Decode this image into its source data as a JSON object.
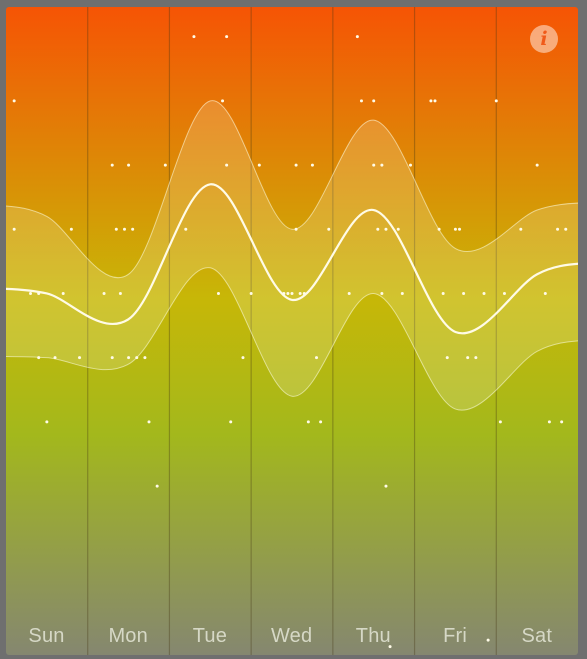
{
  "chart_data": {
    "type": "line",
    "categories": [
      "Sun",
      "Mon",
      "Tue",
      "Wed",
      "Thu",
      "Fri",
      "Sat"
    ],
    "ylim": [
      0,
      10
    ],
    "gradient_colors": [
      "#f65405",
      "#c7b707",
      "#a3b81c",
      "#858770"
    ],
    "series": [
      {
        "values": [
          5.6,
          5.2,
          7.3,
          5.5,
          6.9,
          5.0,
          5.9
        ]
      }
    ],
    "band": {
      "upper": [
        6.8,
        5.9,
        8.6,
        6.6,
        8.3,
        6.3,
        6.9
      ],
      "lower": [
        4.6,
        4.5,
        6.0,
        4.0,
        5.6,
        3.8,
        4.7
      ]
    },
    "points": [
      [
        0.1,
        8.6
      ],
      [
        0.1,
        6.6
      ],
      [
        0.3,
        5.6
      ],
      [
        0.4,
        5.6
      ],
      [
        0.4,
        4.6
      ],
      [
        0.5,
        3.6
      ],
      [
        0.6,
        4.6
      ],
      [
        0.7,
        5.6
      ],
      [
        0.8,
        6.6
      ],
      [
        0.9,
        4.6
      ],
      [
        1.2,
        5.6
      ],
      [
        1.3,
        7.6
      ],
      [
        1.3,
        4.6
      ],
      [
        1.35,
        6.6
      ],
      [
        1.4,
        5.6
      ],
      [
        1.45,
        6.6
      ],
      [
        1.5,
        7.6
      ],
      [
        1.5,
        4.6
      ],
      [
        1.55,
        6.6
      ],
      [
        1.6,
        4.6
      ],
      [
        1.7,
        4.6
      ],
      [
        1.75,
        3.6
      ],
      [
        1.85,
        2.6
      ],
      [
        1.95,
        7.6
      ],
      [
        2.2,
        6.6
      ],
      [
        2.3,
        9.6
      ],
      [
        2.6,
        5.6
      ],
      [
        2.65,
        8.6
      ],
      [
        2.7,
        7.6
      ],
      [
        2.7,
        9.6
      ],
      [
        2.75,
        3.6
      ],
      [
        2.9,
        4.6
      ],
      [
        3.0,
        5.6
      ],
      [
        3.1,
        7.6
      ],
      [
        3.4,
        5.6
      ],
      [
        3.45,
        5.6
      ],
      [
        3.5,
        5.6
      ],
      [
        3.55,
        7.6
      ],
      [
        3.55,
        6.6
      ],
      [
        3.6,
        5.6
      ],
      [
        3.65,
        5.6
      ],
      [
        3.7,
        3.6
      ],
      [
        3.75,
        7.6
      ],
      [
        3.8,
        4.6
      ],
      [
        3.85,
        3.6
      ],
      [
        3.95,
        6.6
      ],
      [
        4.2,
        5.6
      ],
      [
        4.3,
        9.6
      ],
      [
        4.35,
        8.6
      ],
      [
        4.5,
        8.6
      ],
      [
        4.5,
        7.6
      ],
      [
        4.55,
        6.6
      ],
      [
        4.6,
        7.6
      ],
      [
        4.6,
        5.6
      ],
      [
        4.65,
        6.6
      ],
      [
        4.65,
        2.6
      ],
      [
        4.7,
        0.1
      ],
      [
        4.8,
        6.6
      ],
      [
        4.85,
        5.6
      ],
      [
        4.95,
        7.6
      ],
      [
        5.2,
        8.6
      ],
      [
        5.25,
        8.6
      ],
      [
        5.3,
        6.6
      ],
      [
        5.35,
        5.6
      ],
      [
        5.4,
        4.6
      ],
      [
        5.5,
        6.6
      ],
      [
        5.55,
        6.6
      ],
      [
        5.6,
        5.6
      ],
      [
        5.65,
        4.6
      ],
      [
        5.75,
        4.6
      ],
      [
        5.85,
        5.6
      ],
      [
        5.9,
        0.2
      ],
      [
        6.0,
        8.6
      ],
      [
        6.05,
        3.6
      ],
      [
        6.1,
        5.6
      ],
      [
        6.3,
        6.6
      ],
      [
        6.5,
        7.6
      ],
      [
        6.6,
        5.6
      ],
      [
        6.65,
        3.6
      ],
      [
        6.75,
        6.6
      ],
      [
        6.8,
        3.6
      ],
      [
        6.85,
        6.6
      ]
    ]
  }
}
